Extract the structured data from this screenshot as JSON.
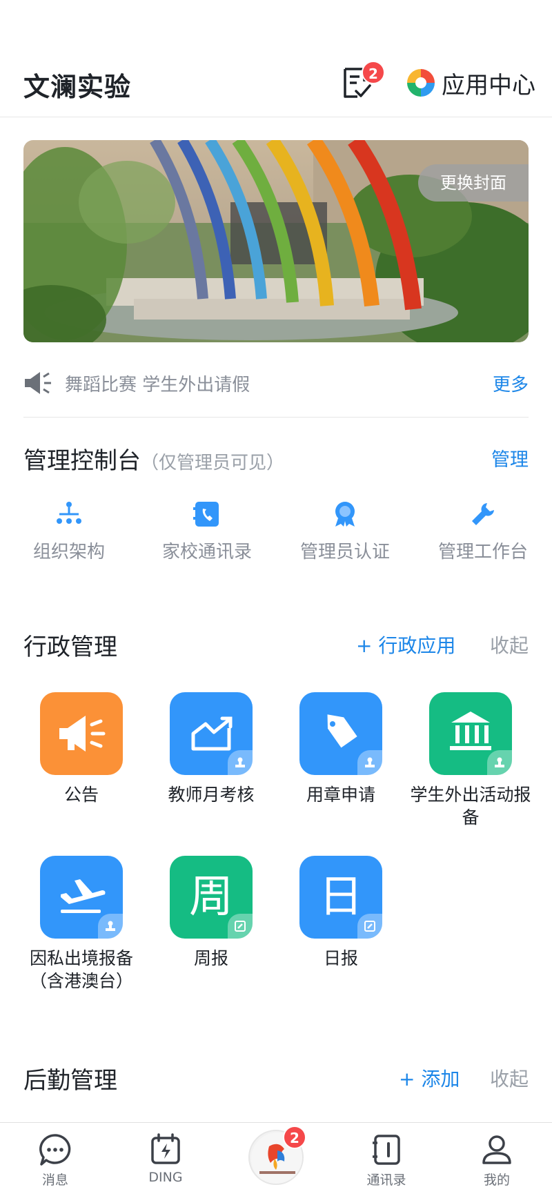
{
  "header": {
    "title": "文澜实验",
    "todo_badge": "2",
    "app_center_label": "应用中心"
  },
  "banner": {
    "change_cover_label": "更换封面"
  },
  "notice": {
    "text": "舞蹈比赛 学生外出请假",
    "more_label": "更多"
  },
  "admin": {
    "title": "管理控制台",
    "subtitle": "（仅管理员可见）",
    "manage_label": "管理",
    "items": [
      {
        "label": "组织架构",
        "icon": "org-chart-icon"
      },
      {
        "label": "家校通讯录",
        "icon": "phone-book-icon"
      },
      {
        "label": "管理员认证",
        "icon": "badge-icon"
      },
      {
        "label": "管理工作台",
        "icon": "wrench-icon"
      }
    ]
  },
  "admin_section": {
    "title": "行政管理",
    "add_label": "+ 行政应用",
    "collapse_label": "收起",
    "apps": [
      {
        "label": "公告",
        "icon": "megaphone-icon",
        "color": "#fb9137"
      },
      {
        "label": "教师月考核",
        "icon": "trend-chart-icon",
        "color": "#3296fa"
      },
      {
        "label": "用章申请",
        "icon": "tag-icon",
        "color": "#3296fa"
      },
      {
        "label": "学生外出活动报备",
        "icon": "bank-icon",
        "color": "#15bc83"
      },
      {
        "label": "因私出境报备（含港澳台）",
        "icon": "plane-icon",
        "color": "#3296fa"
      },
      {
        "label": "周报",
        "icon": "weekly-icon",
        "glyph": "周",
        "color": "#15bc83"
      },
      {
        "label": "日报",
        "icon": "daily-icon",
        "glyph": "日",
        "color": "#3296fa"
      }
    ]
  },
  "logistics_section": {
    "title": "后勤管理",
    "add_label": "+ 添加",
    "collapse_label": "收起"
  },
  "tabbar": {
    "tabs": [
      {
        "label": "消息",
        "icon": "message-icon"
      },
      {
        "label": "DING",
        "icon": "ding-icon"
      },
      {
        "label": "",
        "icon": "school-logo-icon"
      },
      {
        "label": "通讯录",
        "icon": "contacts-icon"
      },
      {
        "label": "我的",
        "icon": "profile-icon"
      }
    ],
    "center_badge": "2"
  },
  "colors": {
    "accent": "#1c86e8",
    "badge": "#f5484a",
    "orange": "#fb9137",
    "blue": "#3296fa",
    "green": "#15bc83"
  }
}
